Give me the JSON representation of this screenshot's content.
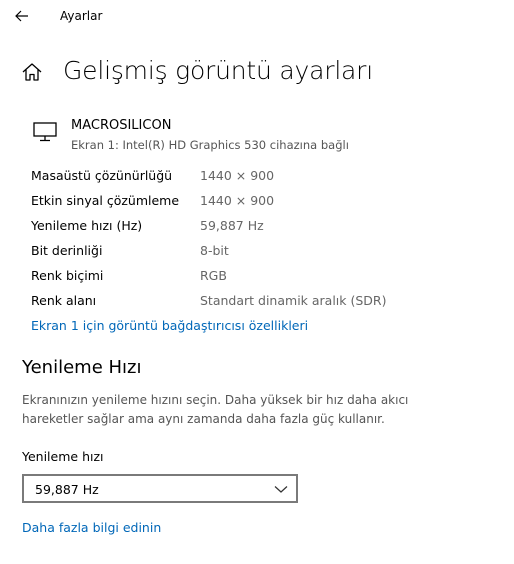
{
  "window": {
    "app_title": "Ayarlar"
  },
  "header": {
    "title": "Gelişmiş görüntü ayarları"
  },
  "display": {
    "name": "MACROSILICON",
    "subtitle": "Ekran 1: Intel(R) HD Graphics 530 cihazına bağlı",
    "info": [
      {
        "label": "Masaüstü çözünürlüğü",
        "value": "1440 × 900"
      },
      {
        "label": "Etkin sinyal çözümleme",
        "value": "1440 × 900"
      },
      {
        "label": "Yenileme hızı (Hz)",
        "value": "59,887 Hz"
      },
      {
        "label": "Bit derinliği",
        "value": "8-bit"
      },
      {
        "label": "Renk biçimi",
        "value": "RGB"
      },
      {
        "label": "Renk alanı",
        "value": "Standart dinamik aralık (SDR)"
      }
    ],
    "adapter_link": "Ekran 1 için görüntü bağdaştırıcısı özellikleri"
  },
  "refresh": {
    "section_title": "Yenileme Hızı",
    "description": "Ekranınızın yenileme hızını seçin. Daha yüksek bir hız daha akıcı hareketler sağlar ama aynı zamanda daha fazla güç kullanır.",
    "select_label": "Yenileme hızı",
    "selected_value": "59,887 Hz",
    "more_info_link": "Daha fazla bilgi edinin"
  },
  "colors": {
    "link": "#0067b8",
    "secondary_text": "#666666"
  },
  "icons": {
    "back": "back-arrow-icon",
    "home": "home-icon",
    "monitor": "monitor-icon",
    "dropdown": "chevron-down-icon"
  }
}
